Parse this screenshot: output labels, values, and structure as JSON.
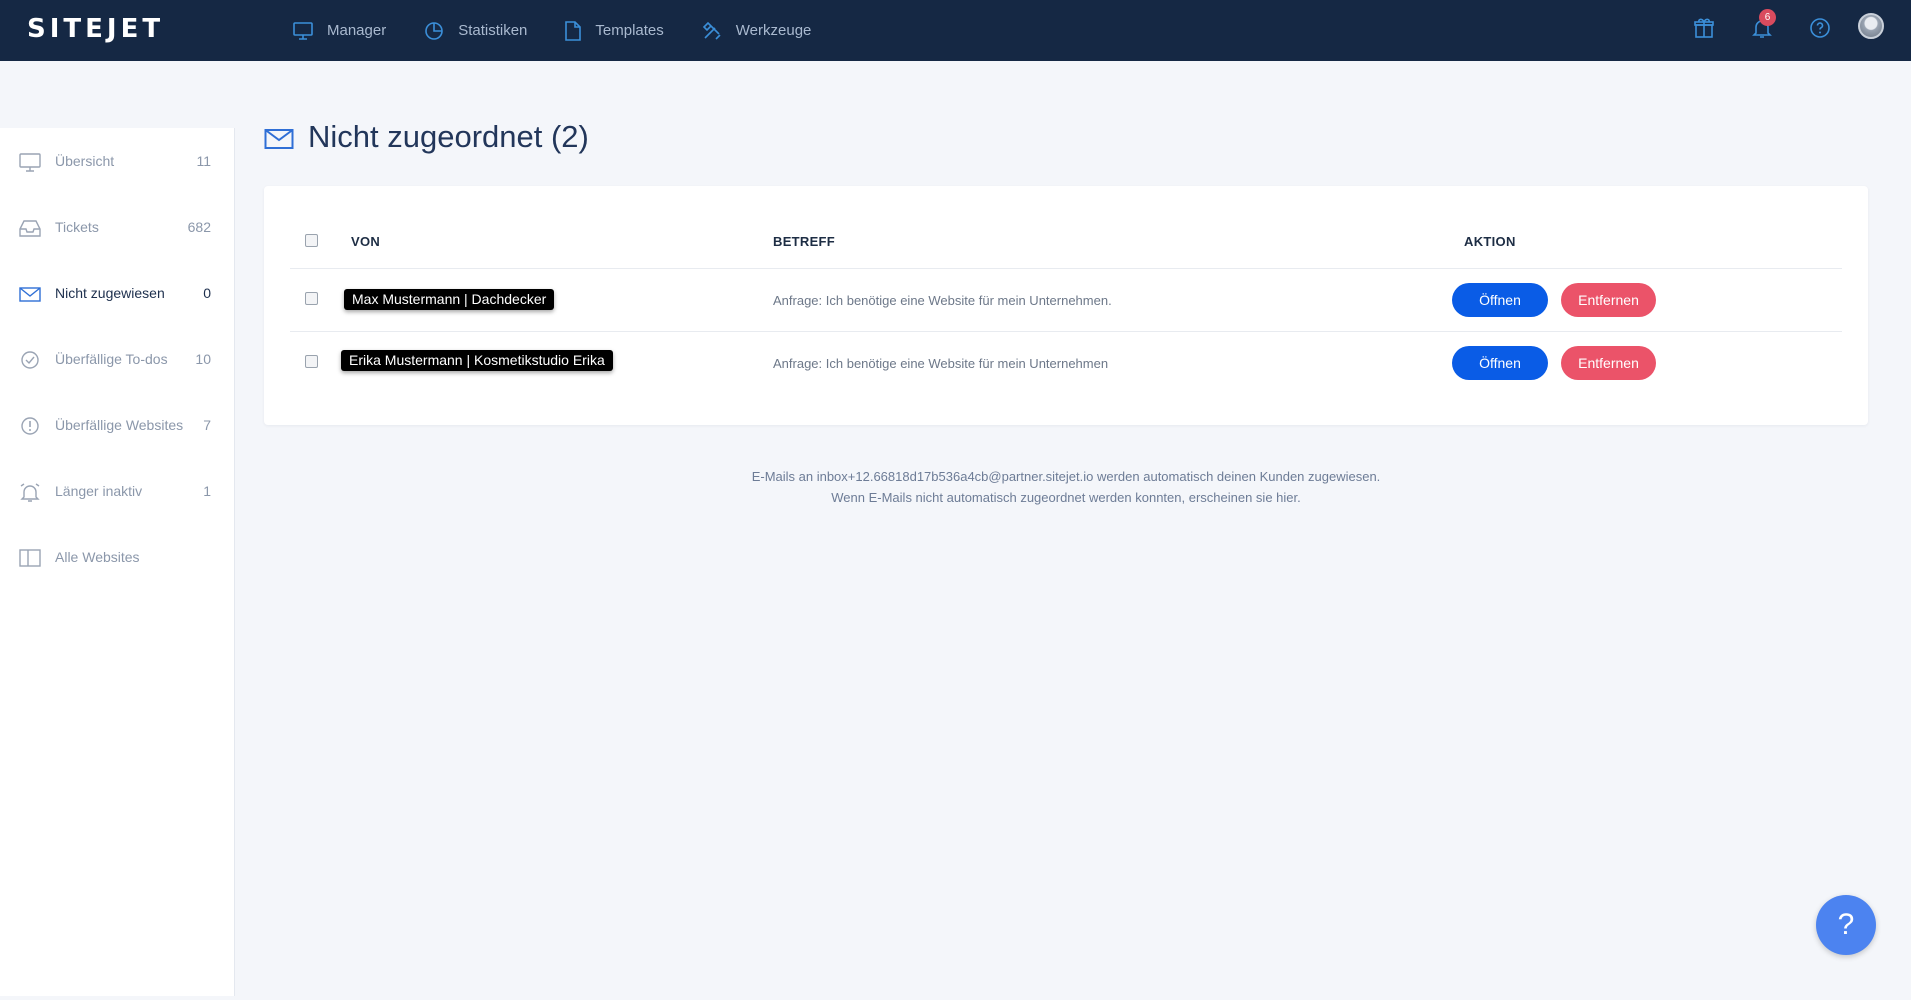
{
  "app": {
    "logo": "SITEJET"
  },
  "nav": {
    "items": [
      {
        "label": "Manager",
        "icon": "monitor-icon"
      },
      {
        "label": "Statistiken",
        "icon": "pie-chart-icon"
      },
      {
        "label": "Templates",
        "icon": "document-icon"
      },
      {
        "label": "Werkzeuge",
        "icon": "tools-icon"
      }
    ],
    "notification_count": "6"
  },
  "sidebar": {
    "items": [
      {
        "label": "Übersicht",
        "count": "11",
        "icon": "monitor-icon"
      },
      {
        "label": "Tickets",
        "count": "682",
        "icon": "inbox-icon"
      },
      {
        "label": "Nicht zugewiesen",
        "count": "0",
        "icon": "envelope-icon",
        "active": true
      },
      {
        "label": "Überfällige To-dos",
        "count": "10",
        "icon": "check-badge-icon"
      },
      {
        "label": "Überfällige Websites",
        "count": "7",
        "icon": "alert-circle-icon"
      },
      {
        "label": "Länger inaktiv",
        "count": "1",
        "icon": "alarm-icon"
      },
      {
        "label": "Alle Websites",
        "count": "",
        "icon": "columns-icon"
      }
    ]
  },
  "main": {
    "title": "Nicht zugeordnet (2)",
    "table": {
      "headers": {
        "from": "VON",
        "subject": "BETREFF",
        "action": "AKTION"
      },
      "rows": [
        {
          "from": "Max Mustermann | Dachdecker",
          "subject": "Anfrage: Ich benötige eine Website für mein Unternehmen."
        },
        {
          "from": "Erika Mustermann | Kosmetikstudio Erika",
          "subject": "Anfrage: Ich benötige eine Website für mein Unternehmen"
        }
      ],
      "open_label": "Öffnen",
      "remove_label": "Entfernen"
    },
    "footnote_line1": "E-Mails an inbox+12.66818d17b536a4cb@partner.sitejet.io werden automatisch deinen Kunden zugewiesen.",
    "footnote_line2": "Wenn E-Mails nicht automatisch zugeordnet werden konnten, erscheinen sie hier."
  },
  "help_fab": {
    "label": "?"
  },
  "colors": {
    "topbar": "#152844",
    "accent": "#0a5ce6",
    "danger": "#eb5369",
    "fab": "#4c83f0"
  }
}
